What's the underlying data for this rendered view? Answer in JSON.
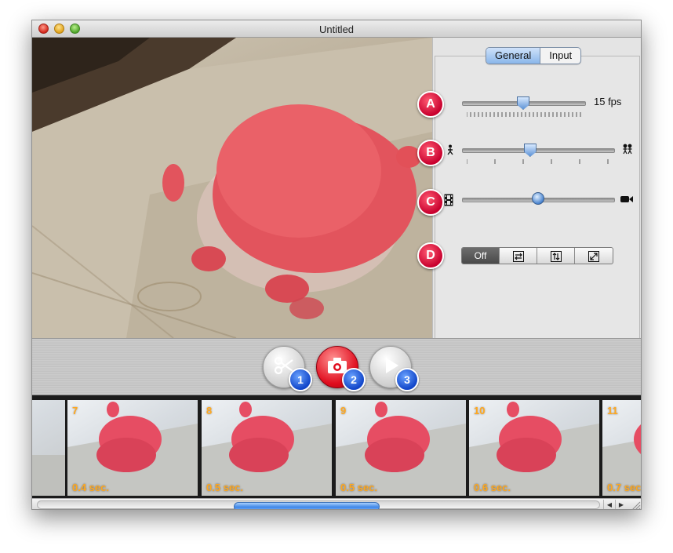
{
  "window": {
    "title": "Untitled"
  },
  "tabs": [
    {
      "label": "General",
      "active": true
    },
    {
      "label": "Input",
      "active": false
    }
  ],
  "settings": {
    "badges": [
      "A",
      "B",
      "C",
      "D"
    ],
    "framerate_label": "15 fps",
    "framerate_level": 0.5,
    "onion_level": 0.45,
    "blend_level": 0.5,
    "mode_segments": [
      "Off",
      "mirror-horizontal-icon",
      "mirror-vertical-icon",
      "flip-both-icon"
    ],
    "mode_selected": "Off"
  },
  "toolbar": {
    "buttons": [
      {
        "icon": "scissors-icon",
        "number": "1"
      },
      {
        "icon": "camera-record-icon",
        "number": "2"
      },
      {
        "icon": "play-icon",
        "number": "3"
      }
    ]
  },
  "filmstrip": {
    "frames": [
      {
        "number": "7",
        "time": "0.4 sec."
      },
      {
        "number": "8",
        "time": "0.5 sec."
      },
      {
        "number": "9",
        "time": "0.5 sec."
      },
      {
        "number": "10",
        "time": "0.6 sec."
      },
      {
        "number": "11",
        "time": "0.7 sec."
      }
    ]
  },
  "scrollbar": {
    "position": 0.47,
    "visible_fraction": 0.26
  },
  "colors": {
    "badge_red": "#d4002f",
    "badge_blue": "#1a56d6",
    "frame_label_orange": "#ffa81f",
    "record_red": "#e00d1e"
  }
}
